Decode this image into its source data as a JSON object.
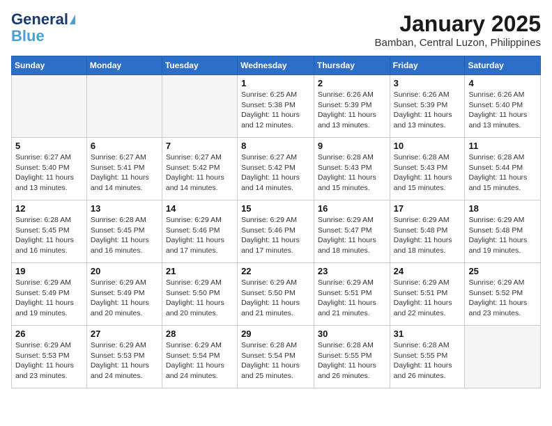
{
  "logo": {
    "line1": "General",
    "line2": "Blue"
  },
  "title": "January 2025",
  "subtitle": "Bamban, Central Luzon, Philippines",
  "headers": [
    "Sunday",
    "Monday",
    "Tuesday",
    "Wednesday",
    "Thursday",
    "Friday",
    "Saturday"
  ],
  "weeks": [
    [
      {
        "day": "",
        "info": ""
      },
      {
        "day": "",
        "info": ""
      },
      {
        "day": "",
        "info": ""
      },
      {
        "day": "1",
        "info": "Sunrise: 6:25 AM\nSunset: 5:38 PM\nDaylight: 11 hours\nand 12 minutes."
      },
      {
        "day": "2",
        "info": "Sunrise: 6:26 AM\nSunset: 5:39 PM\nDaylight: 11 hours\nand 13 minutes."
      },
      {
        "day": "3",
        "info": "Sunrise: 6:26 AM\nSunset: 5:39 PM\nDaylight: 11 hours\nand 13 minutes."
      },
      {
        "day": "4",
        "info": "Sunrise: 6:26 AM\nSunset: 5:40 PM\nDaylight: 11 hours\nand 13 minutes."
      }
    ],
    [
      {
        "day": "5",
        "info": "Sunrise: 6:27 AM\nSunset: 5:40 PM\nDaylight: 11 hours\nand 13 minutes."
      },
      {
        "day": "6",
        "info": "Sunrise: 6:27 AM\nSunset: 5:41 PM\nDaylight: 11 hours\nand 14 minutes."
      },
      {
        "day": "7",
        "info": "Sunrise: 6:27 AM\nSunset: 5:42 PM\nDaylight: 11 hours\nand 14 minutes."
      },
      {
        "day": "8",
        "info": "Sunrise: 6:27 AM\nSunset: 5:42 PM\nDaylight: 11 hours\nand 14 minutes."
      },
      {
        "day": "9",
        "info": "Sunrise: 6:28 AM\nSunset: 5:43 PM\nDaylight: 11 hours\nand 15 minutes."
      },
      {
        "day": "10",
        "info": "Sunrise: 6:28 AM\nSunset: 5:43 PM\nDaylight: 11 hours\nand 15 minutes."
      },
      {
        "day": "11",
        "info": "Sunrise: 6:28 AM\nSunset: 5:44 PM\nDaylight: 11 hours\nand 15 minutes."
      }
    ],
    [
      {
        "day": "12",
        "info": "Sunrise: 6:28 AM\nSunset: 5:45 PM\nDaylight: 11 hours\nand 16 minutes."
      },
      {
        "day": "13",
        "info": "Sunrise: 6:28 AM\nSunset: 5:45 PM\nDaylight: 11 hours\nand 16 minutes."
      },
      {
        "day": "14",
        "info": "Sunrise: 6:29 AM\nSunset: 5:46 PM\nDaylight: 11 hours\nand 17 minutes."
      },
      {
        "day": "15",
        "info": "Sunrise: 6:29 AM\nSunset: 5:46 PM\nDaylight: 11 hours\nand 17 minutes."
      },
      {
        "day": "16",
        "info": "Sunrise: 6:29 AM\nSunset: 5:47 PM\nDaylight: 11 hours\nand 18 minutes."
      },
      {
        "day": "17",
        "info": "Sunrise: 6:29 AM\nSunset: 5:48 PM\nDaylight: 11 hours\nand 18 minutes."
      },
      {
        "day": "18",
        "info": "Sunrise: 6:29 AM\nSunset: 5:48 PM\nDaylight: 11 hours\nand 19 minutes."
      }
    ],
    [
      {
        "day": "19",
        "info": "Sunrise: 6:29 AM\nSunset: 5:49 PM\nDaylight: 11 hours\nand 19 minutes."
      },
      {
        "day": "20",
        "info": "Sunrise: 6:29 AM\nSunset: 5:49 PM\nDaylight: 11 hours\nand 20 minutes."
      },
      {
        "day": "21",
        "info": "Sunrise: 6:29 AM\nSunset: 5:50 PM\nDaylight: 11 hours\nand 20 minutes."
      },
      {
        "day": "22",
        "info": "Sunrise: 6:29 AM\nSunset: 5:50 PM\nDaylight: 11 hours\nand 21 minutes."
      },
      {
        "day": "23",
        "info": "Sunrise: 6:29 AM\nSunset: 5:51 PM\nDaylight: 11 hours\nand 21 minutes."
      },
      {
        "day": "24",
        "info": "Sunrise: 6:29 AM\nSunset: 5:51 PM\nDaylight: 11 hours\nand 22 minutes."
      },
      {
        "day": "25",
        "info": "Sunrise: 6:29 AM\nSunset: 5:52 PM\nDaylight: 11 hours\nand 23 minutes."
      }
    ],
    [
      {
        "day": "26",
        "info": "Sunrise: 6:29 AM\nSunset: 5:53 PM\nDaylight: 11 hours\nand 23 minutes."
      },
      {
        "day": "27",
        "info": "Sunrise: 6:29 AM\nSunset: 5:53 PM\nDaylight: 11 hours\nand 24 minutes."
      },
      {
        "day": "28",
        "info": "Sunrise: 6:29 AM\nSunset: 5:54 PM\nDaylight: 11 hours\nand 24 minutes."
      },
      {
        "day": "29",
        "info": "Sunrise: 6:28 AM\nSunset: 5:54 PM\nDaylight: 11 hours\nand 25 minutes."
      },
      {
        "day": "30",
        "info": "Sunrise: 6:28 AM\nSunset: 5:55 PM\nDaylight: 11 hours\nand 26 minutes."
      },
      {
        "day": "31",
        "info": "Sunrise: 6:28 AM\nSunset: 5:55 PM\nDaylight: 11 hours\nand 26 minutes."
      },
      {
        "day": "",
        "info": ""
      }
    ]
  ],
  "shaded_rows": [
    1,
    3
  ]
}
